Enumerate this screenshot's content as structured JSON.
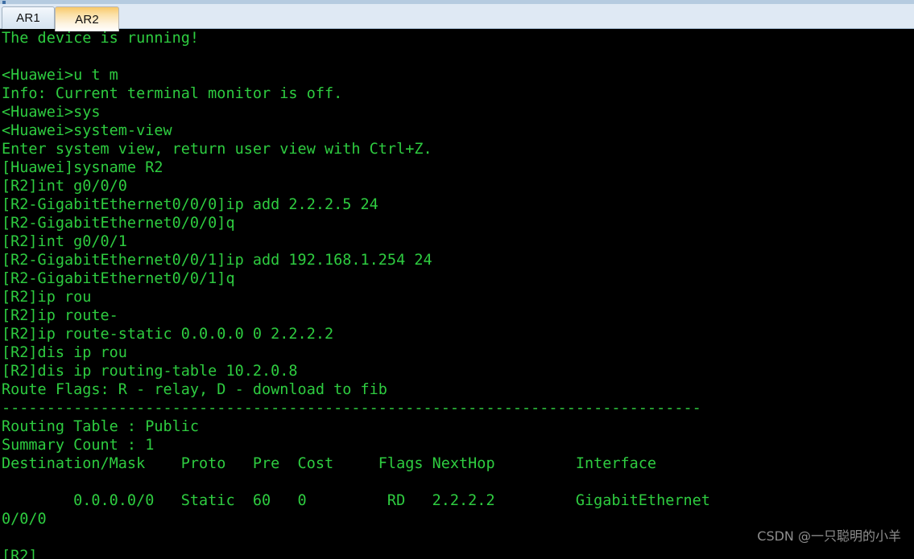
{
  "window": {
    "tabs": [
      {
        "label": "AR1",
        "active": false
      },
      {
        "label": "AR2",
        "active": true
      }
    ]
  },
  "terminal": {
    "foreground_color": "#2ecc40",
    "background_color": "#000000",
    "lines": [
      "The device is running!",
      "",
      "<Huawei>u t m",
      "Info: Current terminal monitor is off.",
      "<Huawei>sys",
      "<Huawei>system-view",
      "Enter system view, return user view with Ctrl+Z.",
      "[Huawei]sysname R2",
      "[R2]int g0/0/0",
      "[R2-GigabitEthernet0/0/0]ip add 2.2.2.5 24",
      "[R2-GigabitEthernet0/0/0]q",
      "[R2]int g0/0/1",
      "[R2-GigabitEthernet0/0/1]ip add 192.168.1.254 24",
      "[R2-GigabitEthernet0/0/1]q",
      "[R2]ip rou",
      "[R2]ip route-",
      "[R2]ip route-static 0.0.0.0 0 2.2.2.2",
      "[R2]dis ip rou",
      "[R2]dis ip routing-table 10.2.0.8",
      "Route Flags: R - relay, D - download to fib",
      "------------------------------------------------------------------------------",
      "Routing Table : Public",
      "Summary Count : 1",
      "Destination/Mask    Proto   Pre  Cost     Flags NextHop         Interface",
      "",
      "        0.0.0.0/0   Static  60   0         RD   2.2.2.2         GigabitEthernet",
      "0/0/0",
      "",
      "[R2]"
    ],
    "routing_table": {
      "route_flags_legend": "Route Flags: R - relay, D - download to fib",
      "table_name": "Routing Table : Public",
      "summary_count": "Summary Count : 1",
      "columns": [
        "Destination/Mask",
        "Proto",
        "Pre",
        "Cost",
        "Flags",
        "NextHop",
        "Interface"
      ],
      "rows": [
        {
          "destination_mask": "0.0.0.0/0",
          "proto": "Static",
          "pre": "60",
          "cost": "0",
          "flags": "RD",
          "nexthop": "2.2.2.2",
          "interface": "GigabitEthernet0/0/0"
        }
      ]
    },
    "prompt": "[R2]"
  },
  "watermark": {
    "text": "CSDN @一只聪明的小羊"
  }
}
